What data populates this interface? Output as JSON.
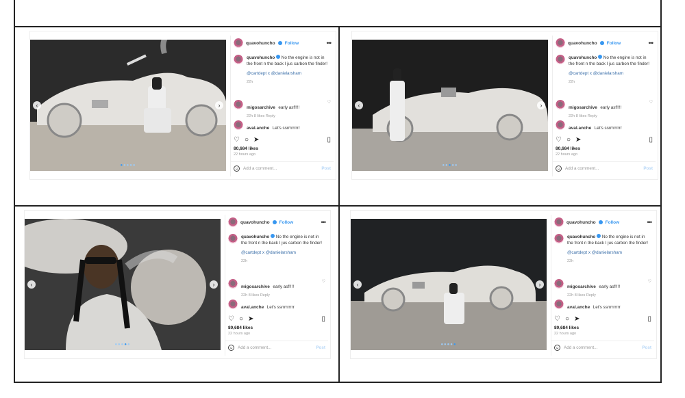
{
  "posts": [
    {
      "username": "quavohuncho",
      "follow_label": "Follow",
      "caption": "No the engine is not in the front n the back I jus carbon the finder!",
      "tags": "@cartdept x @danielarsham",
      "caption_age": "22h",
      "comments": [
        {
          "user": "migosarchive",
          "text": "early asf!!!!",
          "meta": "22h   8 likes   Reply"
        },
        {
          "user": "aval.anche",
          "text": "Let's ssrrrrrrrrr",
          "meta": ""
        }
      ],
      "likes": "80,684 likes",
      "posted": "22 hours ago",
      "add_comment_placeholder": "Add a comment...",
      "post_label": "Post",
      "scene": "car-seated"
    },
    {
      "username": "quavohuncho",
      "follow_label": "Follow",
      "caption": "No the engine is not in the front n the back I jus carbon the finder!",
      "tags": "@cartdept x @danielarsham",
      "caption_age": "22h",
      "comments": [
        {
          "user": "migosarchive",
          "text": "early asf!!!!",
          "meta": "22h   8 likes   Reply"
        },
        {
          "user": "aval.anche",
          "text": "Let's ssrrrrrrrrr",
          "meta": ""
        }
      ],
      "likes": "80,684 likes",
      "posted": "22 hours ago",
      "add_comment_placeholder": "Add a comment...",
      "post_label": "Post",
      "scene": "car-standing"
    },
    {
      "username": "quavohuncho",
      "follow_label": "Follow",
      "caption": "No the engine is not in the front n the back I jus carbon the finder!",
      "tags": "@cartdept x @danielarsham",
      "caption_age": "22h",
      "comments": [
        {
          "user": "migosarchive",
          "text": "early asf!!!!",
          "meta": "22h   8 likes   Reply"
        },
        {
          "user": "aval.anche",
          "text": "Let's ssrrrrrrrrr",
          "meta": ""
        }
      ],
      "likes": "80,684 likes",
      "posted": "22 hours ago",
      "add_comment_placeholder": "Add a comment...",
      "post_label": "Post",
      "scene": "portrait-smoking"
    },
    {
      "username": "quavohuncho",
      "follow_label": "Follow",
      "caption": "No the engine is not in the front n the back I jus carbon the finder!",
      "tags": "@cartdept x @danielarsham",
      "caption_age": "22h",
      "comments": [
        {
          "user": "migosarchive",
          "text": "early asf!!!!",
          "meta": "22h   8 likes   Reply"
        },
        {
          "user": "aval.anche",
          "text": "Let's ssrrrrrrrrr",
          "meta": ""
        }
      ],
      "likes": "80,684 likes",
      "posted": "22 hours ago",
      "add_comment_placeholder": "Add a comment...",
      "post_label": "Post",
      "scene": "car-wide"
    }
  ],
  "icons": {
    "heart": "heart-icon",
    "comment": "comment-icon",
    "share": "share-icon",
    "save": "bookmark-icon",
    "more": "more-options-icon",
    "emoji": "emoji-icon",
    "verified": "verified-badge-icon"
  },
  "colors": {
    "accent": "#3897f0",
    "link": "#3b6fa9",
    "muted": "#999999"
  }
}
